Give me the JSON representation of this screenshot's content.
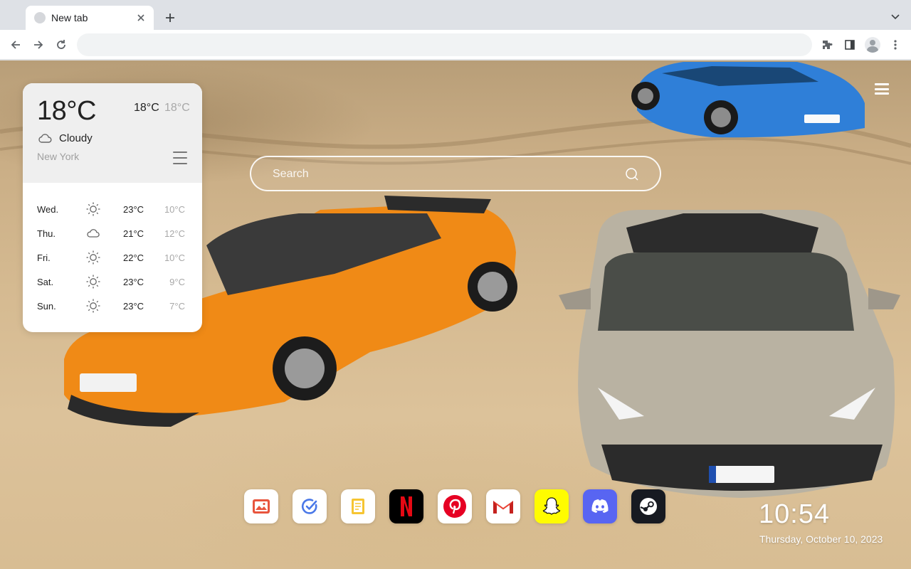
{
  "browser": {
    "tab": {
      "title": "New tab"
    },
    "omnibox": {
      "value": "",
      "placeholder": ""
    }
  },
  "weather": {
    "current_temp": "18°C",
    "high": "18°C",
    "low": "18°C",
    "condition": "Cloudy",
    "condition_icon": "cloud-icon",
    "city": "New York",
    "forecast": [
      {
        "day": "Wed.",
        "icon": "sun-icon",
        "high": "23°C",
        "low": "10°C"
      },
      {
        "day": "Thu.",
        "icon": "cloud-icon",
        "high": "21°C",
        "low": "12°C"
      },
      {
        "day": "Fri.",
        "icon": "sun-icon",
        "high": "22°C",
        "low": "10°C"
      },
      {
        "day": "Sat.",
        "icon": "sun-icon",
        "high": "23°C",
        "low": "9°C"
      },
      {
        "day": "Sun.",
        "icon": "sun-icon",
        "high": "23°C",
        "low": "7°C"
      }
    ]
  },
  "search": {
    "placeholder": "Search"
  },
  "dock": [
    {
      "name": "photos",
      "icon": "photos-icon",
      "color": "#ffffff"
    },
    {
      "name": "tasks",
      "icon": "checkmark-icon",
      "color": "#ffffff"
    },
    {
      "name": "notes",
      "icon": "note-icon",
      "color": "#ffffff"
    },
    {
      "name": "netflix",
      "icon": "netflix-icon",
      "color": "#000000"
    },
    {
      "name": "pinterest",
      "icon": "pinterest-icon",
      "color": "#ffffff"
    },
    {
      "name": "gmail",
      "icon": "gmail-icon",
      "color": "#ffffff"
    },
    {
      "name": "snapchat",
      "icon": "snapchat-icon",
      "color": "#fffc00"
    },
    {
      "name": "discord",
      "icon": "discord-icon",
      "color": "#5865f2"
    },
    {
      "name": "steam",
      "icon": "steam-icon",
      "color": "#171a21"
    }
  ],
  "clock": {
    "time": "10:54",
    "date": "Thursday, October 10, 2023"
  },
  "colors": {
    "accent_white": "#ffffff",
    "widget_bg": "#efefef",
    "sand": "#d5ba91"
  }
}
